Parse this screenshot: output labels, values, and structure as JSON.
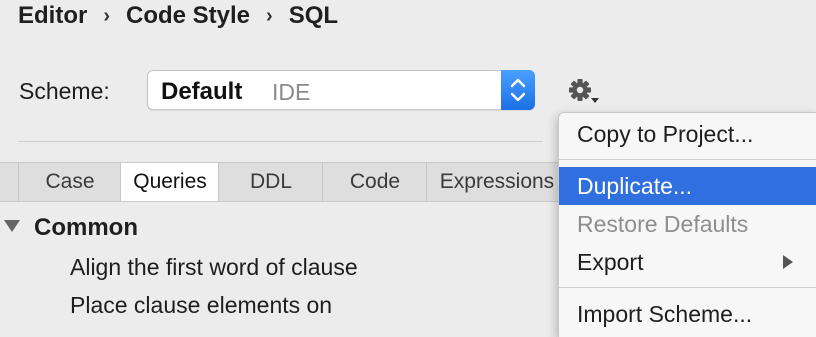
{
  "breadcrumb": [
    "Editor",
    "Code Style",
    "SQL"
  ],
  "breadcrumb_separator": "›",
  "scheme": {
    "label": "Scheme:",
    "name": "Default",
    "kind": "IDE"
  },
  "tabs": [
    "Case",
    "Queries",
    "DDL",
    "Code",
    "Expressions"
  ],
  "active_tab": "Queries",
  "tree": {
    "group": "Common",
    "items": [
      "Align the first word of clause",
      "Place clause elements on"
    ]
  },
  "menu": {
    "copy": "Copy to Project...",
    "duplicate": "Duplicate...",
    "restore": "Restore Defaults",
    "export": "Export",
    "import": "Import Scheme..."
  },
  "colors": {
    "accent": "#2f6fe0",
    "stepper": "#1d6fe6",
    "background": "#ececec"
  },
  "icons": {
    "settings": "gear-icon",
    "stepper": "up-down-chevron-icon",
    "tree_toggle": "triangle-down-icon",
    "submenu": "chevron-right-icon"
  }
}
